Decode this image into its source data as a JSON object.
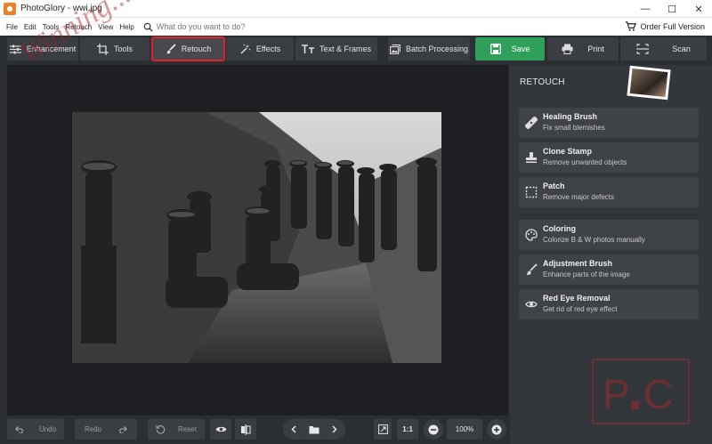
{
  "window": {
    "title": "PhotoGlory - wwi.jpg",
    "controls": [
      "—",
      "☐",
      "✕"
    ]
  },
  "menu": {
    "items": [
      "File",
      "Edit",
      "Tools",
      "Retouch",
      "View",
      "Help"
    ],
    "search_placeholder": "What do you want to do?",
    "order_label": "Order Full Version"
  },
  "toolbar": {
    "enhancement": "Enhancement",
    "tools": "Tools",
    "retouch": "Retouch",
    "effects": "Effects",
    "text_frames": "Text & Frames",
    "batch": "Batch Processing",
    "save": "Save",
    "print": "Print",
    "scan": "Scan",
    "active_tab": "Retouch",
    "highlight_color": "#e0222a",
    "save_color": "#2fa05a"
  },
  "watermark": "Winning...",
  "panel": {
    "title": "RETOUCH",
    "tools": [
      {
        "name": "Healing Brush",
        "desc": "Fix small blemishes",
        "icon": "healing-brush-icon"
      },
      {
        "name": "Clone Stamp",
        "desc": "Remove unwanted objects",
        "icon": "clone-stamp-icon"
      },
      {
        "name": "Patch",
        "desc": "Remove major defects",
        "icon": "patch-icon"
      },
      {
        "name": "Coloring",
        "desc": "Colorize B & W photos manually",
        "icon": "palette-icon"
      },
      {
        "name": "Adjustment Brush",
        "desc": "Enhance parts of the image",
        "icon": "brush-icon"
      },
      {
        "name": "Red Eye Removal",
        "desc": "Get rid of red eye effect",
        "icon": "eye-icon"
      }
    ]
  },
  "bottom": {
    "undo": "Undo",
    "redo": "Redo",
    "reset": "Reset",
    "ratio": "1:1",
    "zoom": "100%"
  }
}
